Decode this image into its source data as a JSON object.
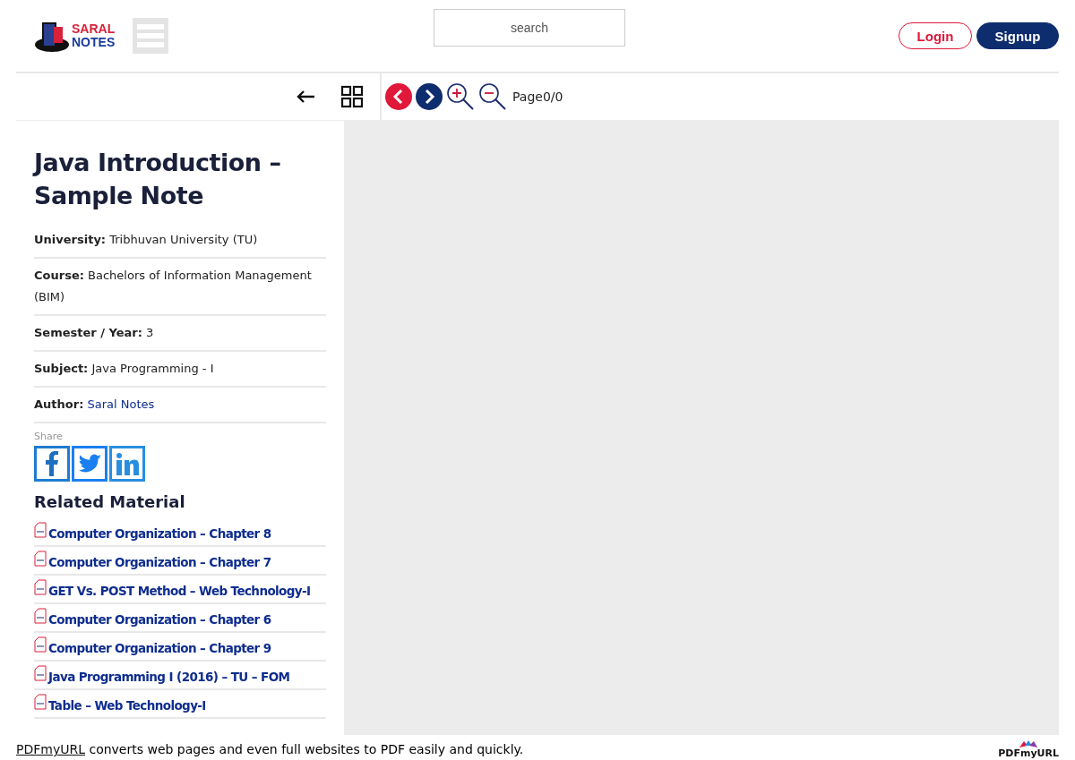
{
  "logo": {
    "line_1": "SARAL",
    "line_2": "NOTES"
  },
  "search": {
    "placeholder": "search"
  },
  "auth_buttons": [
    "Login",
    "Signup"
  ],
  "viewer_toolbar": {
    "page_label": "Page",
    "page_value": "0/0"
  },
  "note": {
    "title": "Java Introduction – Sample Note",
    "details": [
      {
        "label": "University:",
        "value": "Tribhuvan University (TU)",
        "kind": "text"
      },
      {
        "label": "Course:",
        "value": "Bachelors of Information Management (BIM)",
        "kind": "text"
      },
      {
        "label": "Semester / Year:",
        "value": "3",
        "kind": "text"
      },
      {
        "label": "Subject:",
        "value": "Java Programming - I",
        "kind": "text"
      },
      {
        "label": "Author:",
        "value": "Saral Notes",
        "kind": "link"
      }
    ],
    "share_label": "Share"
  },
  "related": {
    "title": "Related Material",
    "items": [
      "Computer Organization – Chapter 8",
      "Computer Organization – Chapter 7",
      "GET Vs. POST Method – Web Technology-I",
      "Computer Organization – Chapter 6",
      "Computer Organization – Chapter 9",
      "Java Programming I (2016) – TU – FOM",
      "Table – Web Technology-I"
    ]
  },
  "footer": {
    "link": "PDFmyURL",
    "text": "converts web pages and even full websites to PDF easily and quickly.",
    "brand": "PDFmyURL"
  }
}
